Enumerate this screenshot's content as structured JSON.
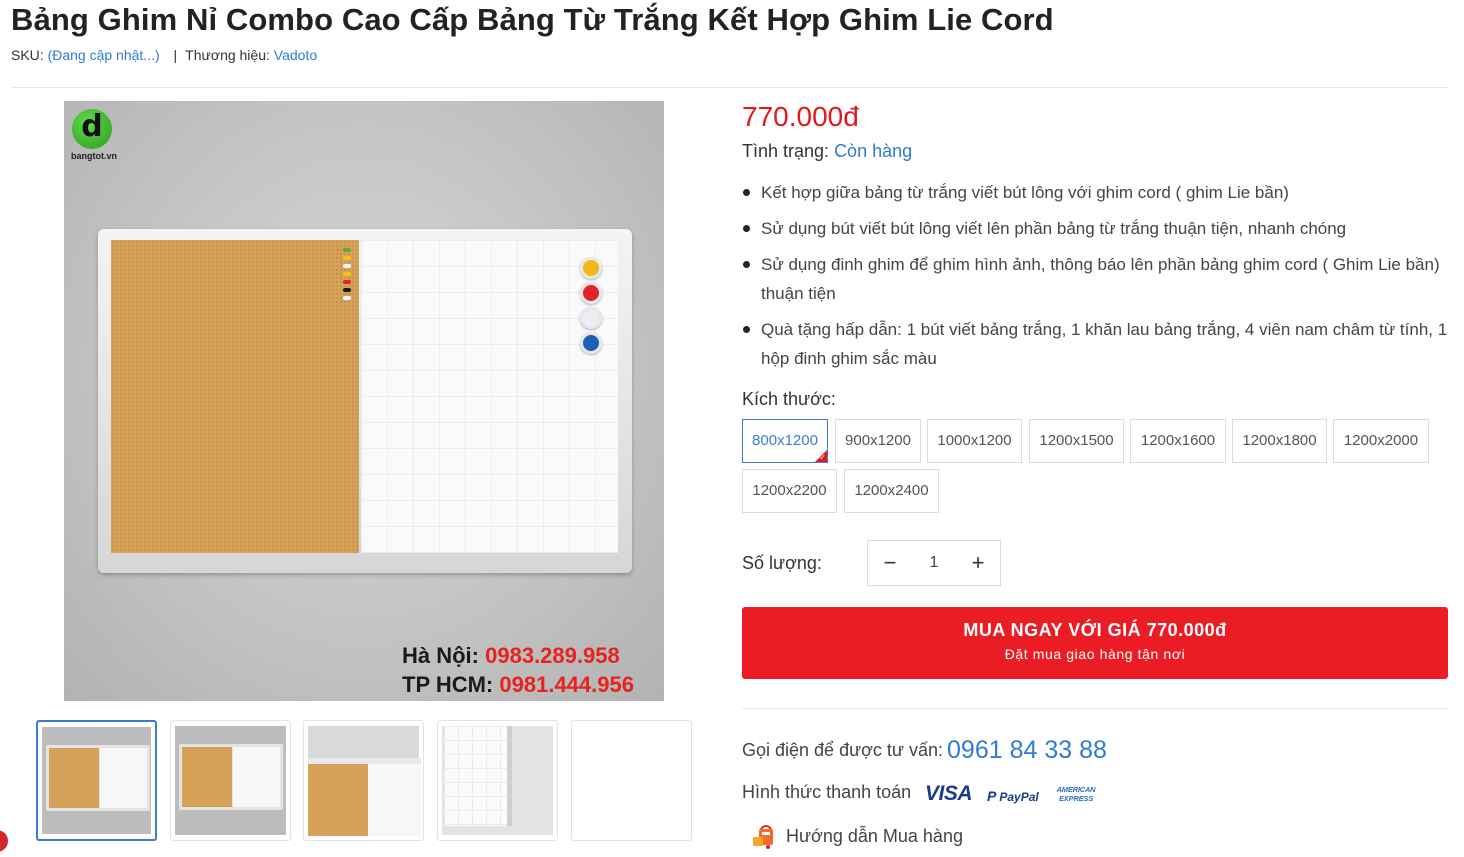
{
  "product": {
    "title": "Bảng Ghim Nỉ Combo Cao Cấp Bảng Từ Trắng Kết Hợp Ghim Lie Cord",
    "sku_label": "SKU:",
    "sku_value": "(Đang cập nhật...)",
    "separator": "|",
    "brand_label": "Thương hiệu:",
    "brand_value": "Vadoto",
    "price": "770.000đ",
    "status_label": "Tình trạng:",
    "status_value": "Còn hàng",
    "features": [
      "Kết hợp giữa bảng từ trắng viết bút lông với ghim cord ( ghim Lie bần)",
      "Sử dụng bút viết bút lông viết lên phần bảng từ trắng thuận tiện, nhanh chóng",
      "Sử dụng đinh ghim để ghim hình ảnh, thông báo lên phần bảng ghim cord ( Ghim Lie bần) thuận tiện",
      "Quà tặng hấp dẫn: 1 bút viết bảng trắng, 1 khăn lau bảng trắng, 4 viên nam châm từ tính, 1 hộp đinh ghim sắc màu"
    ]
  },
  "image": {
    "logo_letter": "d",
    "logo_text": "bangtot.vn",
    "phone_hn_label": "Hà Nội:",
    "phone_hn": "0983.289.958",
    "phone_hcm_label": "TP HCM:",
    "phone_hcm": "0981.444.956",
    "thumbnail_count": 5,
    "active_thumbnail": 1
  },
  "sizes": {
    "label": "Kích thước:",
    "options": [
      "800x1200",
      "900x1200",
      "1000x1200",
      "1200x1500",
      "1200x1600",
      "1200x1800",
      "1200x2000",
      "1200x2200",
      "1200x2400"
    ],
    "selected": "800x1200"
  },
  "quantity": {
    "label": "Số lượng:",
    "minus": "−",
    "value": "1",
    "plus": "+"
  },
  "buy_button": {
    "line1": "MUA NGAY VỚI GIÁ 770.000đ",
    "line2": "Đặt mua giao hàng tận nơi"
  },
  "contact": {
    "call_label": "Gọi điện để được tư vấn:",
    "call_number": "0961 84 33 88",
    "payment_label": "Hình thức thanh toán",
    "payment_methods": [
      "VISA",
      "PayPal",
      "AMERICAN EXPRESS"
    ],
    "guide_label": "Hướng dẫn Mua hàng"
  },
  "colors": {
    "price": "#e3171c",
    "link": "#2f7bd6",
    "buy_button": "#ec1c24",
    "selected_border": "#3a7bd5"
  }
}
